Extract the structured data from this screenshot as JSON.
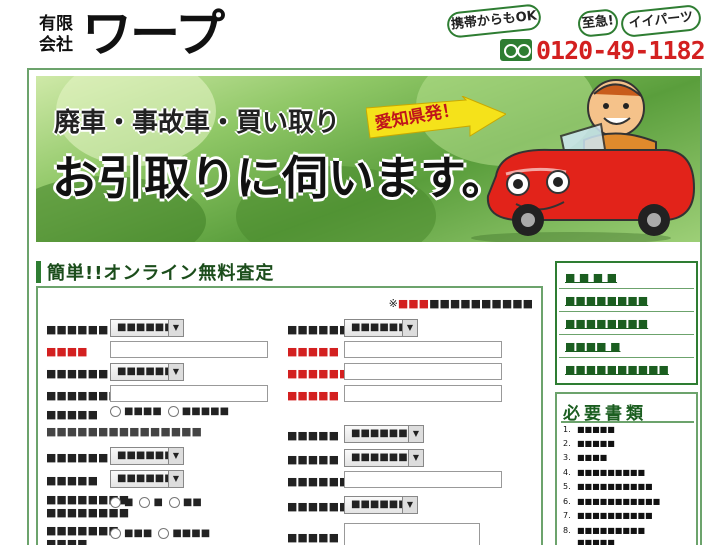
{
  "header": {
    "company_small_line1": "有限",
    "company_small_line2": "会社",
    "company_name": "ワープ",
    "bubble_mobile": "携帯からもOK",
    "bubble_urgent": "至急!",
    "bubble_parts": "イイパーツ",
    "phone": "0120-49-1182"
  },
  "banner": {
    "line1": "廃車・事故車・買い取り",
    "line2": "お引取りに伺います。",
    "region": "愛知県発！"
  },
  "form": {
    "title": "簡単!!オンライン無料査定",
    "required_prefix": "※",
    "required_mark": "■■■",
    "required_suffix": "■■■■■■■■■■",
    "left": {
      "row1_label": "■■■■■■",
      "row1_select": "■■■■■■■",
      "row2_label": "■■■■",
      "row3_label": "■■■■■■",
      "row3_select": "■■■■■■■",
      "row4_label": "■■■■■■■■",
      "row5_label": "■■■■■",
      "row5_opt1": "■■■■",
      "row5_opt2": "■■■■■",
      "note": "■■■■■■■■■■■■■■■",
      "row6_label": "■■■■■■",
      "row6_select": "■■■■■■■",
      "row7_label": "■■■■■",
      "row7_select": "■■■■■■■",
      "row8_label_a": "■■■■■■■■",
      "row8_label_b": "■■■■■■■■",
      "row8_opt1": "■",
      "row8_opt2": "■",
      "row8_opt3": "■■",
      "row9_label_a": "■■■■■■■",
      "row9_label_b": "■■■■",
      "row9_opt1": "■■■",
      "row9_opt2": "■■■■"
    },
    "right": {
      "row1_label": "■■■■■■■",
      "row1_select": "■■■■■■■",
      "row2_label": "■■■■■",
      "row3_label": "■■■■■■",
      "row4_label": "■■■■■",
      "row5_label": "■■■■■",
      "row5_select": "■■■■■■■",
      "row6_label": "■■■■■",
      "row6_select": "■■■■■■■",
      "row7_label": "■■■■■■■",
      "row8_label": "■■■■■■",
      "row8_select": "■■■■■■■",
      "row9_label": "■■■■■"
    }
  },
  "sidebar": {
    "items": [
      "■ ■ ■ ■",
      "■■■■■■■■",
      "■■■■■■■■",
      "■■■■ ■",
      "■■■■■■■■■■"
    ]
  },
  "docs": {
    "title": "必要書類",
    "items": [
      {
        "num": "1.",
        "text": "■■■■■"
      },
      {
        "num": "2.",
        "text": "■■■■■"
      },
      {
        "num": "3.",
        "text": "■■■■"
      },
      {
        "num": "4.",
        "text": "■■■■■■■■■"
      },
      {
        "num": "5.",
        "text": "■■■■■■■■■■"
      },
      {
        "num": "6.",
        "text": "■■■■■■■■■■■"
      },
      {
        "num": "7.",
        "text": "■■■■■■■■■■"
      },
      {
        "num": "8.",
        "text": "■■■■■■■■■"
      },
      {
        "num": "",
        "text": "■■■■■"
      }
    ]
  }
}
